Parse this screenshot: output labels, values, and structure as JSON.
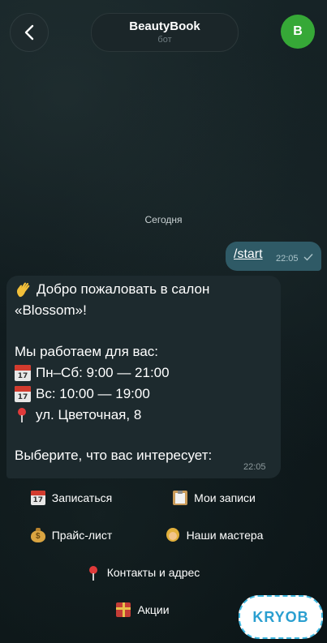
{
  "header": {
    "title": "BeautyBook",
    "subtitle": "бот",
    "avatar_letter": "B"
  },
  "chat": {
    "date_separator": "Сегодня",
    "outgoing": {
      "text": "/start",
      "time": "22:05"
    },
    "incoming": {
      "lines": [
        "Добро пожаловать в салон",
        "«Blossom»!",
        "Мы работаем для вас:",
        "Пн–Сб: 9:00 — 21:00",
        "Вс: 10:00 — 19:00",
        "ул. Цветочная, 8",
        "Выберите, что вас интересует:"
      ],
      "time": "22:05"
    }
  },
  "keyboard": {
    "book": "Записаться",
    "my_bookings": "Мои записи",
    "prices": "Прайс-лист",
    "masters": "Наши мастера",
    "contacts": "Контакты и адрес",
    "promos": "Акции"
  },
  "watermark": "KRYOB",
  "colors": {
    "background": "#0f1a1d",
    "outgoing_bubble": "#2f5a66",
    "incoming_bubble": "#1d2a2e",
    "avatar": "#36a837"
  }
}
